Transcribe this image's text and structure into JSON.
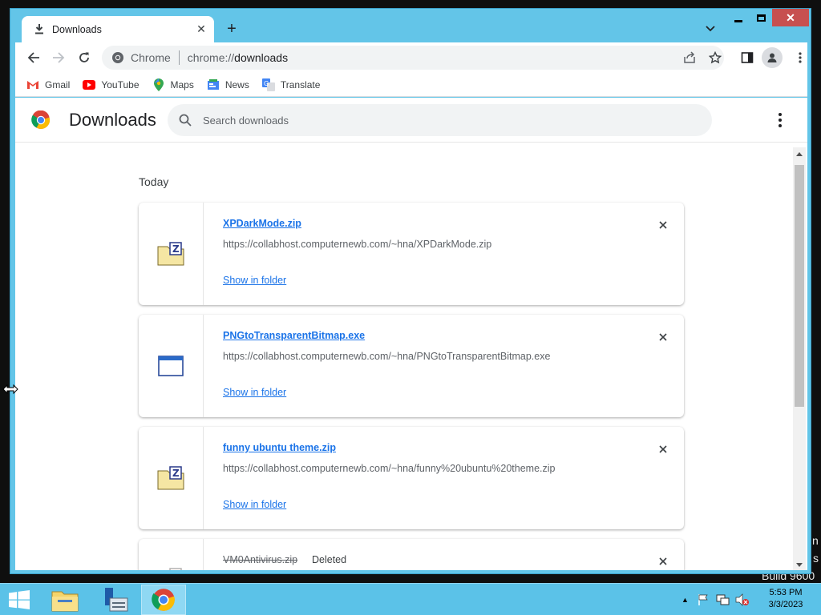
{
  "window": {
    "tab_title": "Downloads",
    "new_tab": "+"
  },
  "toolbar": {
    "site_label": "Chrome",
    "url_scheme": "chrome://",
    "url_host": "downloads"
  },
  "bookmarks": [
    {
      "label": "Gmail",
      "icon": "gmail-icon"
    },
    {
      "label": "YouTube",
      "icon": "youtube-icon"
    },
    {
      "label": "Maps",
      "icon": "maps-icon"
    },
    {
      "label": "News",
      "icon": "news-icon"
    },
    {
      "label": "Translate",
      "icon": "translate-icon"
    }
  ],
  "downloads_page": {
    "title": "Downloads",
    "search_placeholder": "Search downloads",
    "section": "Today",
    "items": [
      {
        "name": "XPDarkMode.zip",
        "url": "https://collabhost.computernewb.com/~hna/XPDarkMode.zip",
        "action": "Show in folder",
        "icon": "zip-file-icon"
      },
      {
        "name": "PNGtoTransparentBitmap.exe",
        "url": "https://collabhost.computernewb.com/~hna/PNGtoTransparentBitmap.exe",
        "action": "Show in folder",
        "icon": "exe-file-icon"
      },
      {
        "name": "funny ubuntu theme.zip",
        "url": "https://collabhost.computernewb.com/~hna/funny%20ubuntu%20theme.zip",
        "action": "Show in folder",
        "icon": "zip-file-icon"
      },
      {
        "name": "VM0Antivirus.zip",
        "status": "Deleted",
        "icon": "zip-file-icon"
      }
    ]
  },
  "desktop": {
    "build_text": "Build 9600",
    "edge_text_1": "n",
    "edge_text_2": "s"
  },
  "taskbar": {
    "time": "5:53 PM",
    "date": "3/3/2023"
  },
  "colors": {
    "window_frame": "#63c5e8",
    "taskbar": "#5bc2e8",
    "link": "#1a73e8",
    "close_button": "#c75050"
  }
}
